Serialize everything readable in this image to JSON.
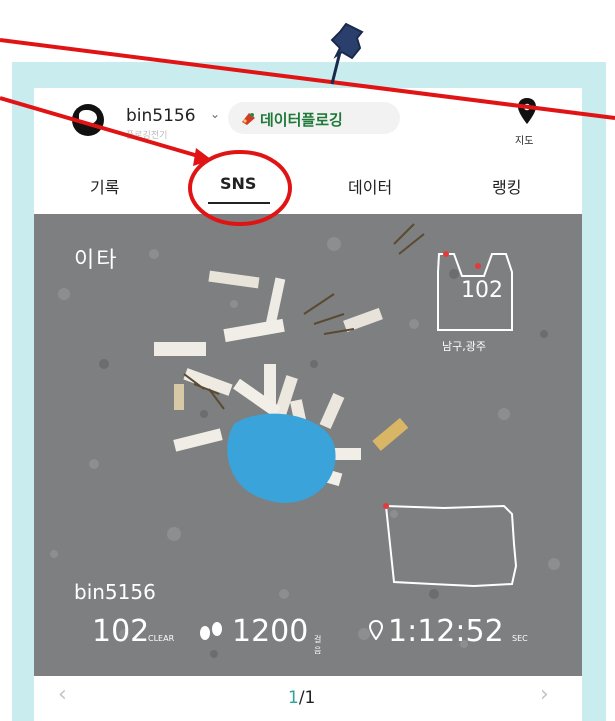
{
  "header": {
    "username": "bin5156",
    "subtitle": "플로깅전기",
    "brand": "데이터플로깅",
    "map_label": "지도"
  },
  "tabs": [
    {
      "label": "기록",
      "active": false
    },
    {
      "label": "SNS",
      "active": true
    },
    {
      "label": "데이터",
      "active": false
    },
    {
      "label": "랭킹",
      "active": false
    }
  ],
  "post": {
    "photo_tag": "이타",
    "bag_count": "102",
    "area": "남구,광주",
    "user": "bin5156",
    "stats": {
      "trash": "102",
      "trash_unit": "CLEAR",
      "steps": "1200",
      "steps_unit": "걸음",
      "time": "1:12:52",
      "time_unit": "SEC"
    }
  },
  "pager": {
    "current": "1",
    "total": "/1"
  },
  "icons": {
    "pin": "pushpin-icon",
    "map": "map-pin-icon",
    "prev": "chevron-left-icon",
    "next": "chevron-right-icon"
  },
  "colors": {
    "frame": "#c9ecef",
    "annotation": "#e01414",
    "pin": "#2a3f6b",
    "brand": "#1f7a3a",
    "pager_current": "#2ba59a"
  }
}
